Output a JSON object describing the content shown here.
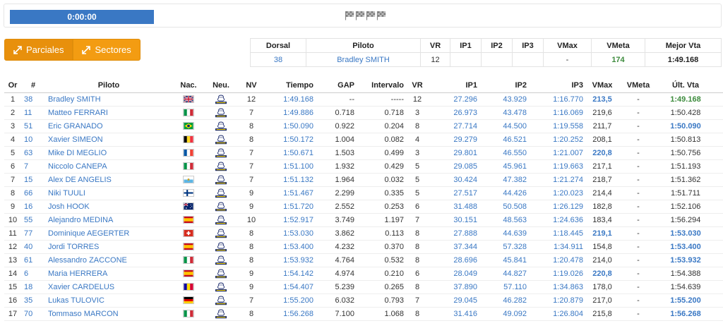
{
  "timer": "0:00:00",
  "flags_count": 4,
  "buttons": {
    "parciales": "Parciales",
    "sectores": "Sectores"
  },
  "summary": {
    "headers": [
      "Dorsal",
      "Piloto",
      "VR",
      "IP1",
      "IP2",
      "IP3",
      "VMax",
      "VMeta",
      "Mejor Vta"
    ],
    "dorsal": "38",
    "piloto": "Bradley SMITH",
    "vr": "12",
    "ip1": "",
    "ip2": "",
    "ip3": "",
    "vmax": "-",
    "vmeta": "174",
    "mejor": "1:49.168"
  },
  "table": {
    "headers": [
      "Or",
      "#",
      "Piloto",
      "Nac.",
      "Neu.",
      "NV",
      "Tiempo",
      "GAP",
      "Intervalo",
      "VR",
      "IP1",
      "IP2",
      "IP3",
      "VMax",
      "VMeta",
      "Últ. Vta"
    ],
    "rows": [
      {
        "or": "1",
        "num": "38",
        "name": "Bradley SMITH",
        "nat": "GB",
        "nv": "12",
        "time": "1:49.168",
        "gap": "--",
        "int": "-----",
        "vr": "12",
        "ip1": "27.296",
        "ip2": "43.929",
        "ip3": "1:16.770",
        "vmax": "213,5",
        "vmax_best": true,
        "vmeta": "-",
        "last": "1:49.168",
        "last_style": "green"
      },
      {
        "or": "2",
        "num": "11",
        "name": "Matteo FERRARI",
        "nat": "IT",
        "nv": "7",
        "time": "1:49.886",
        "gap": "0.718",
        "int": "0.718",
        "vr": "3",
        "ip1": "26.973",
        "ip2": "43.478",
        "ip3": "1:16.069",
        "vmax": "219,6",
        "vmax_best": false,
        "vmeta": "-",
        "last": "1:50.428",
        "last_style": "plain"
      },
      {
        "or": "3",
        "num": "51",
        "name": "Eric GRANADO",
        "nat": "BR",
        "nv": "8",
        "time": "1:50.090",
        "gap": "0.922",
        "int": "0.204",
        "vr": "8",
        "ip1": "27.714",
        "ip2": "44.500",
        "ip3": "1:19.558",
        "vmax": "211,7",
        "vmax_best": false,
        "vmeta": "-",
        "last": "1:50.090",
        "last_style": "best"
      },
      {
        "or": "4",
        "num": "10",
        "name": "Xavier SIMEON",
        "nat": "BE",
        "nv": "8",
        "time": "1:50.172",
        "gap": "1.004",
        "int": "0.082",
        "vr": "4",
        "ip1": "29.279",
        "ip2": "46.521",
        "ip3": "1:20.252",
        "vmax": "208,1",
        "vmax_best": false,
        "vmeta": "-",
        "last": "1:50.813",
        "last_style": "plain"
      },
      {
        "or": "5",
        "num": "63",
        "name": "Mike DI MEGLIO",
        "nat": "FR",
        "nv": "7",
        "time": "1:50.671",
        "gap": "1.503",
        "int": "0.499",
        "vr": "3",
        "ip1": "29.801",
        "ip2": "46.550",
        "ip3": "1:21.007",
        "vmax": "220,8",
        "vmax_best": true,
        "vmeta": "-",
        "last": "1:50.756",
        "last_style": "plain"
      },
      {
        "or": "6",
        "num": "7",
        "name": "Niccolo CANEPA",
        "nat": "IT",
        "nv": "7",
        "time": "1:51.100",
        "gap": "1.932",
        "int": "0.429",
        "vr": "5",
        "ip1": "29.085",
        "ip2": "45.961",
        "ip3": "1:19.663",
        "vmax": "217,1",
        "vmax_best": false,
        "vmeta": "-",
        "last": "1:51.193",
        "last_style": "plain"
      },
      {
        "or": "7",
        "num": "15",
        "name": "Alex DE ANGELIS",
        "nat": "SM",
        "nv": "7",
        "time": "1:51.132",
        "gap": "1.964",
        "int": "0.032",
        "vr": "5",
        "ip1": "30.424",
        "ip2": "47.382",
        "ip3": "1:21.274",
        "vmax": "218,7",
        "vmax_best": false,
        "vmeta": "-",
        "last": "1:51.362",
        "last_style": "plain"
      },
      {
        "or": "8",
        "num": "66",
        "name": "Niki TUULI",
        "nat": "FI",
        "nv": "9",
        "time": "1:51.467",
        "gap": "2.299",
        "int": "0.335",
        "vr": "5",
        "ip1": "27.517",
        "ip2": "44.426",
        "ip3": "1:20.023",
        "vmax": "214,4",
        "vmax_best": false,
        "vmeta": "-",
        "last": "1:51.711",
        "last_style": "plain"
      },
      {
        "or": "9",
        "num": "16",
        "name": "Josh HOOK",
        "nat": "AU",
        "nv": "9",
        "time": "1:51.720",
        "gap": "2.552",
        "int": "0.253",
        "vr": "6",
        "ip1": "31.488",
        "ip2": "50.508",
        "ip3": "1:26.129",
        "vmax": "182,8",
        "vmax_best": false,
        "vmeta": "-",
        "last": "1:52.106",
        "last_style": "plain"
      },
      {
        "or": "10",
        "num": "55",
        "name": "Alejandro MEDINA",
        "nat": "ES",
        "nv": "10",
        "time": "1:52.917",
        "gap": "3.749",
        "int": "1.197",
        "vr": "7",
        "ip1": "30.151",
        "ip2": "48.563",
        "ip3": "1:24.636",
        "vmax": "183,4",
        "vmax_best": false,
        "vmeta": "-",
        "last": "1:56.294",
        "last_style": "plain"
      },
      {
        "or": "11",
        "num": "77",
        "name": "Dominique AEGERTER",
        "nat": "CH",
        "nv": "8",
        "time": "1:53.030",
        "gap": "3.862",
        "int": "0.113",
        "vr": "8",
        "ip1": "27.888",
        "ip2": "44.639",
        "ip3": "1:18.445",
        "vmax": "219,1",
        "vmax_best": true,
        "vmeta": "-",
        "last": "1:53.030",
        "last_style": "best"
      },
      {
        "or": "12",
        "num": "40",
        "name": "Jordi TORRES",
        "nat": "ES",
        "nv": "8",
        "time": "1:53.400",
        "gap": "4.232",
        "int": "0.370",
        "vr": "8",
        "ip1": "37.344",
        "ip2": "57.328",
        "ip3": "1:34.911",
        "vmax": "154,8",
        "vmax_best": false,
        "vmeta": "-",
        "last": "1:53.400",
        "last_style": "best"
      },
      {
        "or": "13",
        "num": "61",
        "name": "Alessandro ZACCONE",
        "nat": "IT",
        "nv": "8",
        "time": "1:53.932",
        "gap": "4.764",
        "int": "0.532",
        "vr": "8",
        "ip1": "28.696",
        "ip2": "45.841",
        "ip3": "1:20.478",
        "vmax": "214,0",
        "vmax_best": false,
        "vmeta": "-",
        "last": "1:53.932",
        "last_style": "best"
      },
      {
        "or": "14",
        "num": "6",
        "name": "Maria HERRERA",
        "nat": "ES",
        "nv": "9",
        "time": "1:54.142",
        "gap": "4.974",
        "int": "0.210",
        "vr": "6",
        "ip1": "28.049",
        "ip2": "44.827",
        "ip3": "1:19.026",
        "vmax": "220,8",
        "vmax_best": true,
        "vmeta": "-",
        "last": "1:54.388",
        "last_style": "plain"
      },
      {
        "or": "15",
        "num": "18",
        "name": "Xavier CARDELUS",
        "nat": "AD",
        "nv": "9",
        "time": "1:54.407",
        "gap": "5.239",
        "int": "0.265",
        "vr": "8",
        "ip1": "37.890",
        "ip2": "57.110",
        "ip3": "1:34.863",
        "vmax": "178,0",
        "vmax_best": false,
        "vmeta": "-",
        "last": "1:54.639",
        "last_style": "plain"
      },
      {
        "or": "16",
        "num": "35",
        "name": "Lukas TULOVIC",
        "nat": "DE",
        "nv": "7",
        "time": "1:55.200",
        "gap": "6.032",
        "int": "0.793",
        "vr": "7",
        "ip1": "29.045",
        "ip2": "46.282",
        "ip3": "1:20.879",
        "vmax": "217,0",
        "vmax_best": false,
        "vmeta": "-",
        "last": "1:55.200",
        "last_style": "best"
      },
      {
        "or": "17",
        "num": "70",
        "name": "Tommaso MARCON",
        "nat": "IT",
        "nv": "8",
        "time": "1:56.268",
        "gap": "7.100",
        "int": "1.068",
        "vr": "8",
        "ip1": "31.416",
        "ip2": "49.092",
        "ip3": "1:26.804",
        "vmax": "215,8",
        "vmax_best": false,
        "vmeta": "-",
        "last": "1:56.268",
        "last_style": "best"
      }
    ]
  },
  "colors": {
    "accent_blue": "#3a78c4",
    "orange": "#f39c12",
    "green": "#3d8b3d",
    "home_red": "#c0392b"
  }
}
